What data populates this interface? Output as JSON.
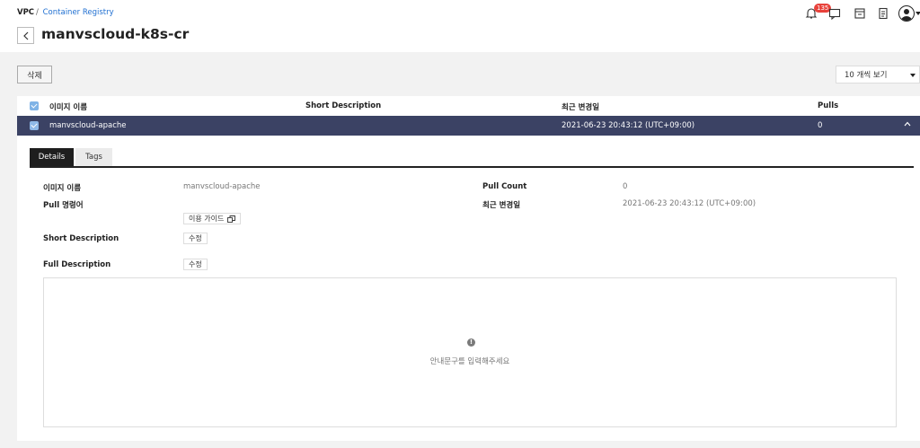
{
  "breadcrumb": {
    "root": "VPC",
    "separator": "/",
    "link": "Container Registry"
  },
  "page": {
    "title": "manvscloud-k8s-cr"
  },
  "top_icons": {
    "notifications_count": "135",
    "icons": [
      "bell-icon",
      "chat-icon",
      "archive-icon",
      "document-icon",
      "user-avatar-icon"
    ]
  },
  "toolbar": {
    "delete_label": "삭제",
    "page_size_label": "10 개씩 보기"
  },
  "table": {
    "headers": [
      "이미지 이름",
      "Short Description",
      "최근 변경일",
      "Pulls"
    ],
    "row": {
      "name": "manvscloud-apache",
      "short_description": "",
      "updated": "2021-06-23 20:43:12 (UTC+09:00)",
      "pulls": "0"
    }
  },
  "detail": {
    "tabs": [
      "Details",
      "Tags"
    ],
    "active_tab": "Details",
    "image_name_label": "이미지 이름",
    "image_name_value": "manvscloud-apache",
    "pull_cmd_label": "Pull 명령어",
    "guide_button": "이용 가이드",
    "short_desc_label": "Short Description",
    "edit_label": "수정",
    "full_desc_label": "Full Description",
    "pull_count_label": "Pull Count",
    "pull_count_value": "0",
    "updated_label": "최근 변경일",
    "updated_value": "2021-06-23 20:43:12 (UTC+09:00)",
    "placeholder": "안내문구를 입력해주세요"
  },
  "colors": {
    "selected_row": "#3b4264",
    "link": "#1f6fd1",
    "badge": "#e8423b"
  }
}
